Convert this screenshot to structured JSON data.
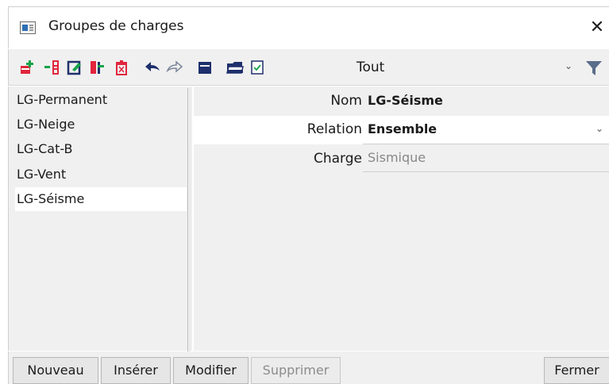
{
  "window": {
    "title": "Groupes de charges",
    "close_glyph": "✕",
    "icons": {
      "app": "window-app-icon",
      "close": "close-icon"
    }
  },
  "toolbar": {
    "icons": [
      "new-item-icon",
      "insert-item-icon",
      "edit-item-icon",
      "copy-item-icon",
      "delete-item-icon",
      "undo-icon",
      "redo-icon",
      "table-view-icon",
      "folder-open-icon",
      "checklist-icon"
    ],
    "filter": {
      "value": "Tout",
      "chevron": "⌄"
    },
    "filter_icon": "funnel-icon"
  },
  "list": {
    "items": [
      "LG-Permanent",
      "LG-Neige",
      "LG-Cat-B",
      "LG-Vent",
      "LG-Séisme"
    ],
    "selected": "LG-Séisme"
  },
  "properties": {
    "nom": {
      "label": "Nom",
      "value": "LG-Séisme"
    },
    "relation": {
      "label": "Relation",
      "value": "Ensemble",
      "chevron": "⌄"
    },
    "charge": {
      "label": "Charge",
      "value": "Sismique"
    }
  },
  "buttons": {
    "nouveau": "Nouveau",
    "inserer": "Insérer",
    "modifier": "Modifier",
    "supprimer": "Supprimer",
    "fermer": "Fermer"
  },
  "colors": {
    "accent_red": "#e0263c",
    "accent_green": "#17a34a",
    "navy": "#1e2f6b",
    "funnel": "#5a6d8a"
  }
}
